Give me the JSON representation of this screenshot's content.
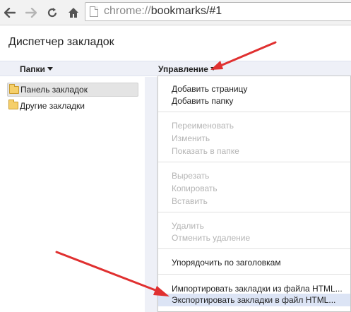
{
  "toolbar": {
    "url_scheme": "chrome://",
    "url_rest": "bookmarks/#1"
  },
  "page": {
    "title": "Диспетчер закладок"
  },
  "headers": {
    "folders": "Папки",
    "organize": "Управление"
  },
  "tree": {
    "items": [
      {
        "label": "Панель закладок"
      },
      {
        "label": "Другие закладки"
      }
    ]
  },
  "menu": {
    "items": [
      {
        "label": "Добавить страницу"
      },
      {
        "label": "Добавить папку"
      },
      {
        "label": "Переименовать"
      },
      {
        "label": "Изменить"
      },
      {
        "label": "Показать в папке"
      },
      {
        "label": "Вырезать"
      },
      {
        "label": "Копировать"
      },
      {
        "label": "Вставить"
      },
      {
        "label": "Удалить"
      },
      {
        "label": "Отменить удаление"
      },
      {
        "label": "Упорядочить по заголовкам"
      },
      {
        "label": "Импортировать закладки из файла HTML..."
      },
      {
        "label": "Экспортировать закладки в файл HTML..."
      }
    ]
  },
  "colors": {
    "arrow": "#e03030",
    "menu_hover": "#dce4f5",
    "header_bar": "#eef0f7"
  }
}
